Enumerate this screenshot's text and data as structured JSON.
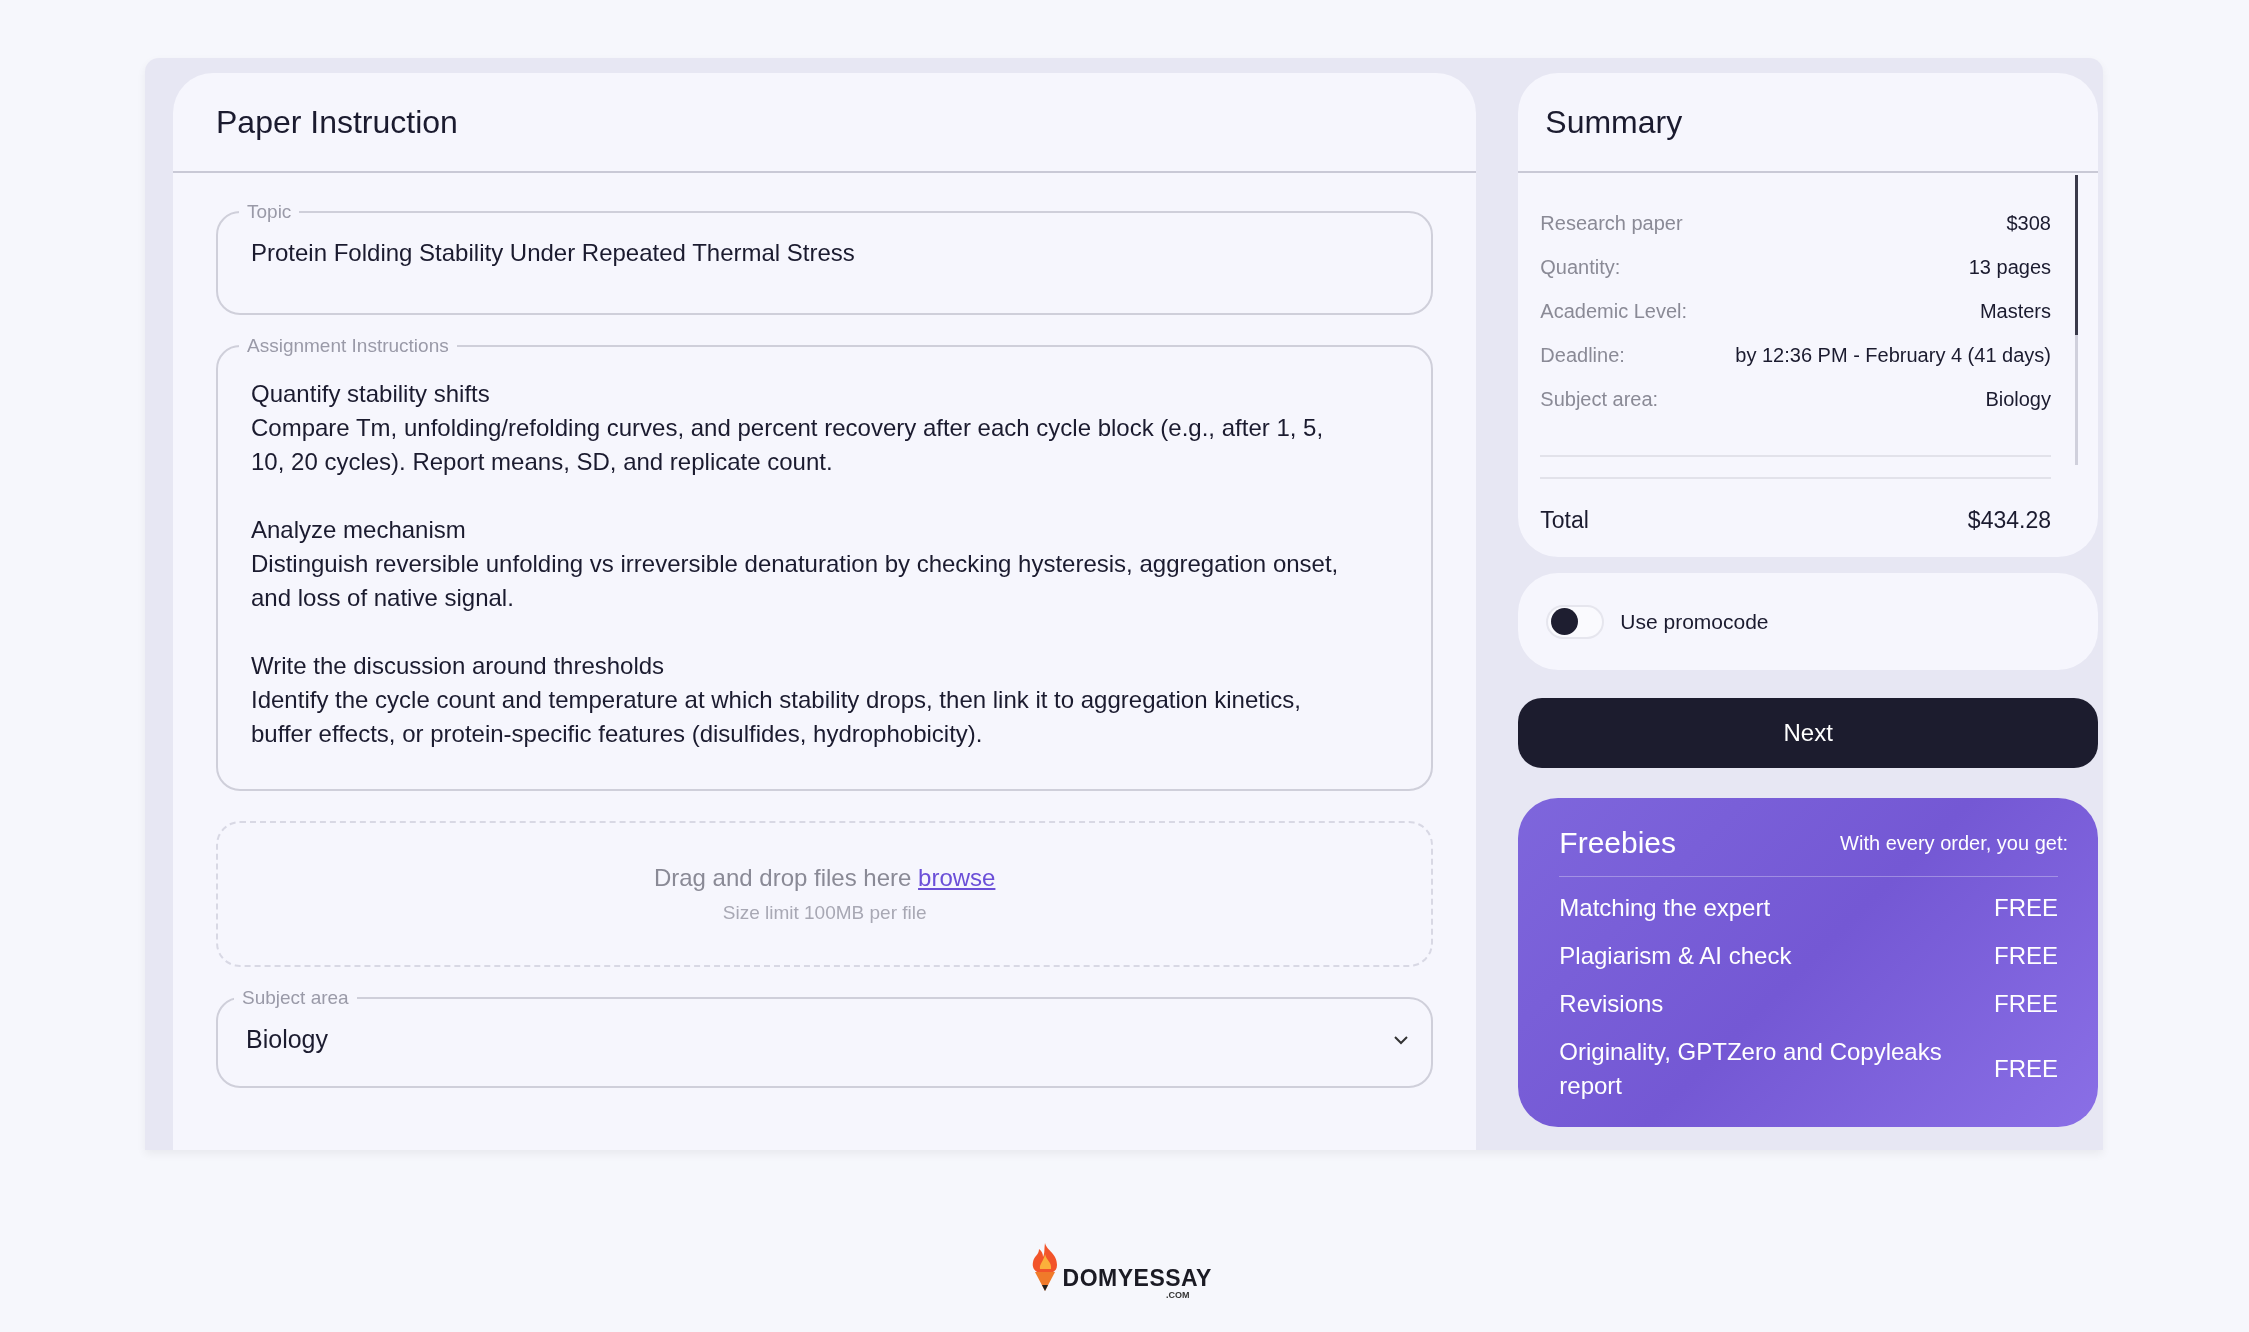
{
  "paper_instruction": {
    "title": "Paper Instruction",
    "topic": {
      "label": "Topic",
      "value": "Protein Folding Stability Under Repeated Thermal Stress"
    },
    "instructions": {
      "label": "Assignment Instructions",
      "blocks": [
        {
          "heading": "Quantify stability shifts",
          "body": "Compare Tm, unfolding/refolding curves, and percent recovery after each cycle block (e.g., after 1, 5, 10, 20 cycles). Report means, SD, and replicate count."
        },
        {
          "heading": "Analyze mechanism",
          "body": "Distinguish reversible unfolding vs irreversible denaturation by checking hysteresis, aggregation onset, and loss of native signal."
        },
        {
          "heading": "Write the discussion around thresholds",
          "body": "Identify the cycle count and temperature at which stability drops, then link it to aggregation kinetics, buffer effects, or protein-specific features (disulfides, hydrophobicity)."
        }
      ]
    },
    "upload": {
      "text": "Drag and drop files here",
      "link": "browse",
      "hint": "Size limit 100MB per file"
    },
    "subject": {
      "label": "Subject area",
      "value": "Biology"
    }
  },
  "summary": {
    "title": "Summary",
    "rows": [
      {
        "label": "Research paper",
        "value": "$308"
      },
      {
        "label": "Quantity:",
        "value": "13 pages"
      },
      {
        "label": "Academic Level:",
        "value": "Masters"
      },
      {
        "label": "Deadline:",
        "value": "by 12:36 PM - February 4 (41 days)"
      },
      {
        "label": "Subject area:",
        "value": "Biology"
      }
    ],
    "total": {
      "label": "Total",
      "value": "$434.28"
    }
  },
  "promocode": {
    "label": "Use promocode",
    "on": false
  },
  "next_button": "Next",
  "freebies": {
    "title": "Freebies",
    "subtitle": "With every order, you get:",
    "items": [
      {
        "label": "Matching the expert",
        "value": "FREE"
      },
      {
        "label": "Plagiarism & AI check",
        "value": "FREE"
      },
      {
        "label": "Revisions",
        "value": "FREE"
      },
      {
        "label": "Originality, GPTZero and Copyleaks report",
        "value": "FREE"
      }
    ]
  },
  "logo": {
    "name": "DOMYESSAY",
    "suffix": ".COM"
  }
}
